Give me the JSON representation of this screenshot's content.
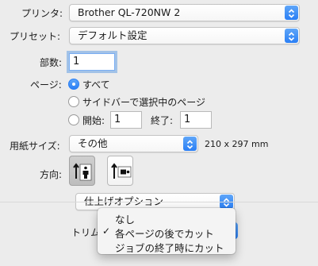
{
  "printer": {
    "label": "プリンタ:",
    "value": "Brother QL-720NW 2"
  },
  "preset": {
    "label": "プリセット:",
    "value": "デフォルト設定"
  },
  "copies": {
    "label": "部数:",
    "value": "1"
  },
  "pages": {
    "label": "ページ:",
    "all": "すべて",
    "selection": "サイドバーで選択中のページ",
    "from_label": "開始:",
    "from_value": "1",
    "to_label": "終了:",
    "to_value": "1"
  },
  "paper": {
    "label": "用紙サイズ:",
    "value": "その他",
    "size": "210 x 297 mm"
  },
  "orientation": {
    "label": "方向:"
  },
  "section": {
    "value": "仕上げオプション"
  },
  "trim": {
    "label": "トリム"
  },
  "trim_menu": {
    "items": [
      "なし",
      "各ページの後でカット",
      "ジョブの終了時にカット"
    ],
    "checked_index": 1,
    "check_mark": "✓"
  },
  "colors": {
    "accent": "#2a7ff5",
    "window_bg": "#ececec"
  }
}
